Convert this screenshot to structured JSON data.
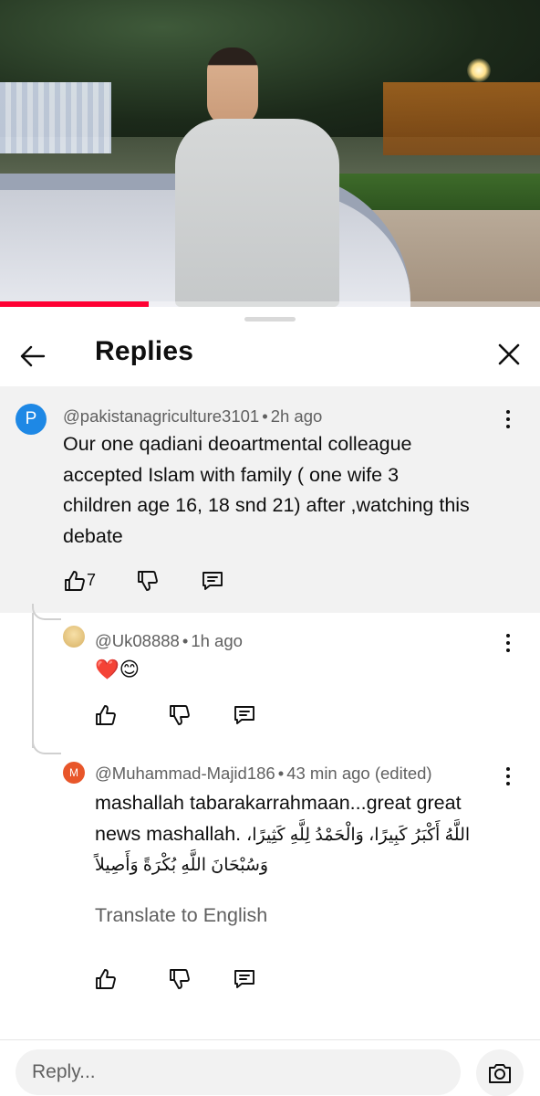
{
  "video": {
    "progress_fraction": 0.275
  },
  "header": {
    "title": "Replies"
  },
  "parent_comment": {
    "avatar_letter": "P",
    "author": "@pakistanagriculture3101",
    "time": "2h ago",
    "text_lines": [
      "Our one qadiani deoartmental colleague",
      "accepted Islam with family ( one wife 3",
      "children age 16, 18 snd 21) after ,watching this",
      "debate"
    ],
    "likes": "7"
  },
  "replies": [
    {
      "author": "@Uk08888",
      "time": "1h ago",
      "emoji_heart": "❤️",
      "emoji_smile": "😊"
    },
    {
      "avatar_letter": "M",
      "author": "@Muhammad-Majid186",
      "time": "43 min ago (edited)",
      "line1": "mashallah tabarakarrahmaan...great great",
      "line2_latin": "news mashallah.",
      "line2_arabic": "اللَّهُ أَكْبَرُ كَبِيرًا، وَالْحَمْدُ لِلَّهِ كَثِيرًا،",
      "line3_arabic": "وَسُبْحَانَ اللَّهِ بُكْرَةً وَأَصِيلاً",
      "translate_label": "Translate to English"
    }
  ],
  "reply_bar": {
    "placeholder": "Reply..."
  },
  "dot": "•"
}
